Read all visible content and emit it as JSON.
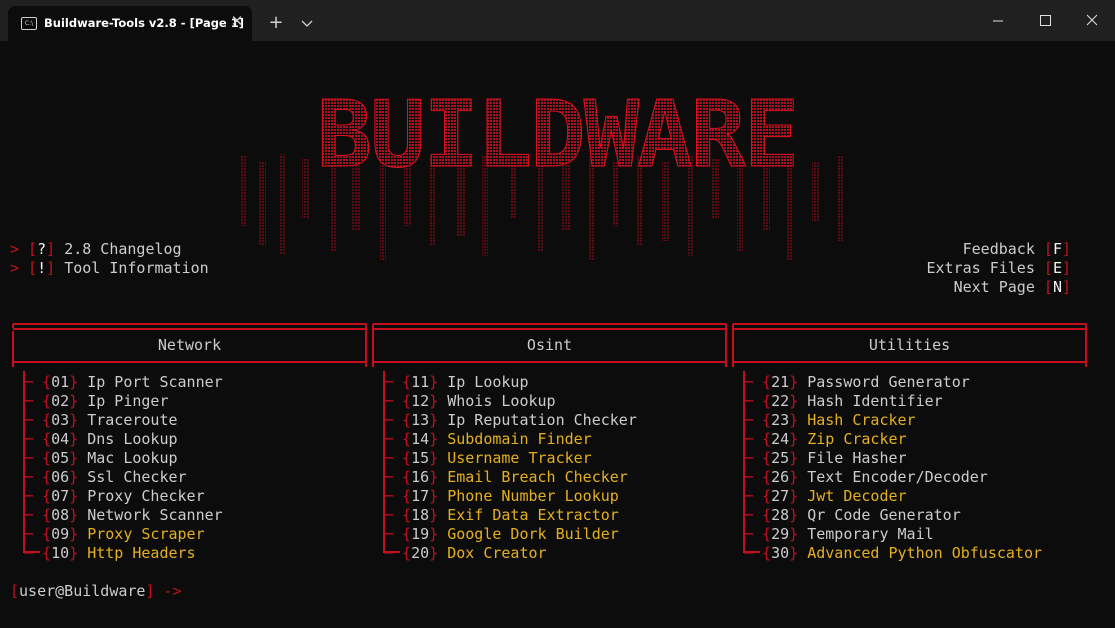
{
  "window": {
    "tab_title": "Buildware-Tools v2.8 - [Page 1]",
    "tab_icon": "terminal-icon",
    "new_tab": "+",
    "close_tab": "✕"
  },
  "banner": {
    "text": "BUILDWARE"
  },
  "top_left": [
    {
      "bracket": "?",
      "label": "2.8 Changelog"
    },
    {
      "bracket": "!",
      "label": "Tool Information"
    }
  ],
  "top_right": [
    {
      "label": "Feedback",
      "key": "F"
    },
    {
      "label": "Extras Files",
      "key": "E"
    },
    {
      "label": "Next Page",
      "key": "N"
    }
  ],
  "columns": [
    {
      "title": "Network",
      "items": [
        {
          "num": "01",
          "label": "Ip Port Scanner",
          "hl": false
        },
        {
          "num": "02",
          "label": "Ip Pinger",
          "hl": false
        },
        {
          "num": "03",
          "label": "Traceroute",
          "hl": false
        },
        {
          "num": "04",
          "label": "Dns Lookup",
          "hl": false
        },
        {
          "num": "05",
          "label": "Mac Lookup",
          "hl": false
        },
        {
          "num": "06",
          "label": "Ssl Checker",
          "hl": false
        },
        {
          "num": "07",
          "label": "Proxy Checker",
          "hl": false
        },
        {
          "num": "08",
          "label": "Network Scanner",
          "hl": false
        },
        {
          "num": "09",
          "label": "Proxy Scraper",
          "hl": true
        },
        {
          "num": "10",
          "label": "Http Headers",
          "hl": true
        }
      ]
    },
    {
      "title": "Osint",
      "items": [
        {
          "num": "11",
          "label": "Ip Lookup",
          "hl": false
        },
        {
          "num": "12",
          "label": "Whois Lookup",
          "hl": false
        },
        {
          "num": "13",
          "label": "Ip Reputation Checker",
          "hl": false
        },
        {
          "num": "14",
          "label": "Subdomain Finder",
          "hl": true
        },
        {
          "num": "15",
          "label": "Username Tracker",
          "hl": true
        },
        {
          "num": "16",
          "label": "Email Breach Checker",
          "hl": true
        },
        {
          "num": "17",
          "label": "Phone Number Lookup",
          "hl": true
        },
        {
          "num": "18",
          "label": "Exif Data Extractor",
          "hl": true
        },
        {
          "num": "19",
          "label": "Google Dork Builder",
          "hl": true
        },
        {
          "num": "20",
          "label": "Dox Creator",
          "hl": true
        }
      ]
    },
    {
      "title": "Utilities",
      "items": [
        {
          "num": "21",
          "label": "Password Generator",
          "hl": false
        },
        {
          "num": "22",
          "label": "Hash Identifier",
          "hl": false
        },
        {
          "num": "23",
          "label": "Hash Cracker",
          "hl": true
        },
        {
          "num": "24",
          "label": "Zip Cracker",
          "hl": true
        },
        {
          "num": "25",
          "label": "File Hasher",
          "hl": false
        },
        {
          "num": "26",
          "label": "Text Encoder/Decoder",
          "hl": false
        },
        {
          "num": "27",
          "label": "Jwt Decoder",
          "hl": true
        },
        {
          "num": "28",
          "label": "Qr Code Generator",
          "hl": false
        },
        {
          "num": "29",
          "label": "Temporary Mail",
          "hl": false
        },
        {
          "num": "30",
          "label": "Advanced Python Obfuscator",
          "hl": true
        }
      ]
    }
  ],
  "prompt": {
    "user": "user@Buildware",
    "arrow": "->"
  },
  "colors": {
    "red": "#c50f1f",
    "gold": "#e5b01e",
    "text": "#cccccc",
    "bg": "#0c0c0c"
  }
}
